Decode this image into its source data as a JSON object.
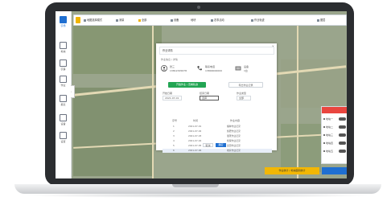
{
  "toolbar": {
    "items": [
      "地图选择模式",
      "测量",
      "全部",
      "设备",
      "地块",
      "农事活动",
      "作业轨迹",
      "图层"
    ]
  },
  "nav": {
    "items": [
      "农场",
      "地块",
      "农事",
      "作业",
      "报表",
      "设备",
      "设置"
    ]
  },
  "modal": {
    "title": "作业详情",
    "subtitle": "作业信息 / 详情",
    "cards": [
      {
        "name": "张三",
        "number": "13812345678"
      },
      {
        "name": "联系电话",
        "number": "13800000000"
      },
      {
        "name": "设备",
        "number": "1台"
      }
    ],
    "btn_primary": "开始作业 / 查看轨迹",
    "btn_secondary": "导出作业记录",
    "fields": {
      "label1": "开始日期",
      "value1": "2021-07-01",
      "label2": "结束日期",
      "value2": "选择",
      "label3": "作业类型",
      "value3": "全部"
    },
    "table": {
      "headers": [
        "序号",
        "时间",
        "作业内容"
      ],
      "rows": [
        [
          "1",
          "2021-07-01",
          "播种作业记录"
        ],
        [
          "2",
          "2021-07-02",
          "施肥作业记录"
        ],
        [
          "3",
          "2021-07-03",
          "灌溉作业记录"
        ],
        [
          "4",
          "2021-07-04",
          "植保作业记录"
        ],
        [
          "5",
          "2021-07-05",
          "巡田作业记录"
        ],
        [
          "6",
          "2021-07-06",
          "收获作业记录"
        ]
      ]
    },
    "cancel": "取消",
    "ok": "确定"
  },
  "right_panel": {
    "rows": [
      "地块一",
      "地块二",
      "地块三",
      "地块四",
      "地块五"
    ]
  },
  "bottom_bar": {
    "text": "作业统计 / 地块面积统计"
  },
  "colors": {
    "accent": "#1f6fd1",
    "green": "#22a553",
    "warning": "#f2b705",
    "danger": "#e9463f"
  }
}
